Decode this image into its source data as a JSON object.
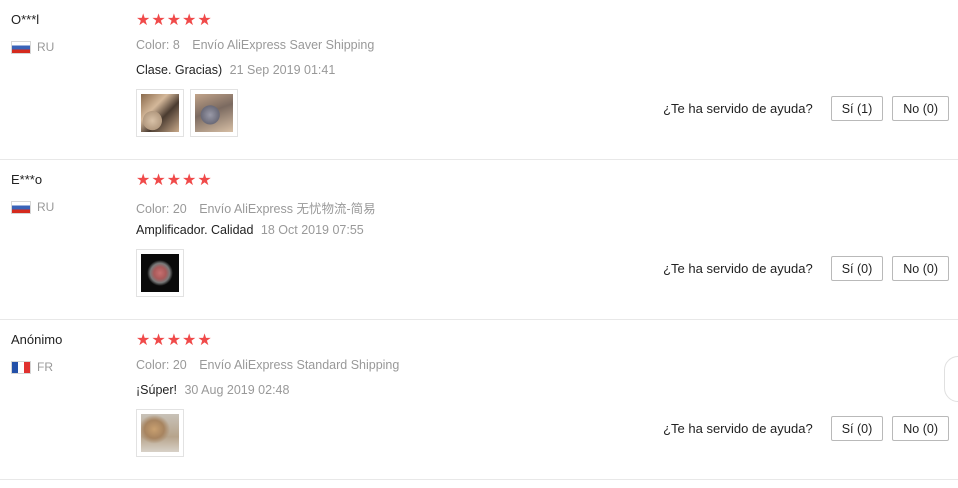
{
  "stars_glyph": "★",
  "colors": {
    "star": "#f04a4a",
    "muted": "#999999",
    "text": "#222222"
  },
  "reviews": [
    {
      "user": "O***l",
      "country": "RU",
      "flag_icon": "russia-flag-icon",
      "rating": 5,
      "color": "Color: 8",
      "shipping": "Envío AliExpress Saver Shipping",
      "feedback": "Clase. Gracias)",
      "date": "21 Sep 2019 01:41",
      "helpful_question": "¿Te ha servido de ayuda?",
      "yes_label": "Sí (1)",
      "no_label": "No (0)"
    },
    {
      "user": "E***o",
      "country": "RU",
      "flag_icon": "russia-flag-icon",
      "rating": 5,
      "color": "Color: 20",
      "shipping": "Envío AliExpress 无忧物流-简易",
      "feedback": "Amplificador. Calidad",
      "date": "18 Oct 2019 07:55",
      "helpful_question": "¿Te ha servido de ayuda?",
      "yes_label": "Sí (0)",
      "no_label": "No (0)"
    },
    {
      "user": "Anónimo",
      "country": "FR",
      "flag_icon": "france-flag-icon",
      "rating": 5,
      "color": "Color: 20",
      "shipping": "Envío AliExpress Standard Shipping",
      "feedback": "¡Súper!",
      "date": "30 Aug 2019 02:48",
      "helpful_question": "¿Te ha servido de ayuda?",
      "yes_label": "Sí (0)",
      "no_label": "No (0)"
    }
  ]
}
